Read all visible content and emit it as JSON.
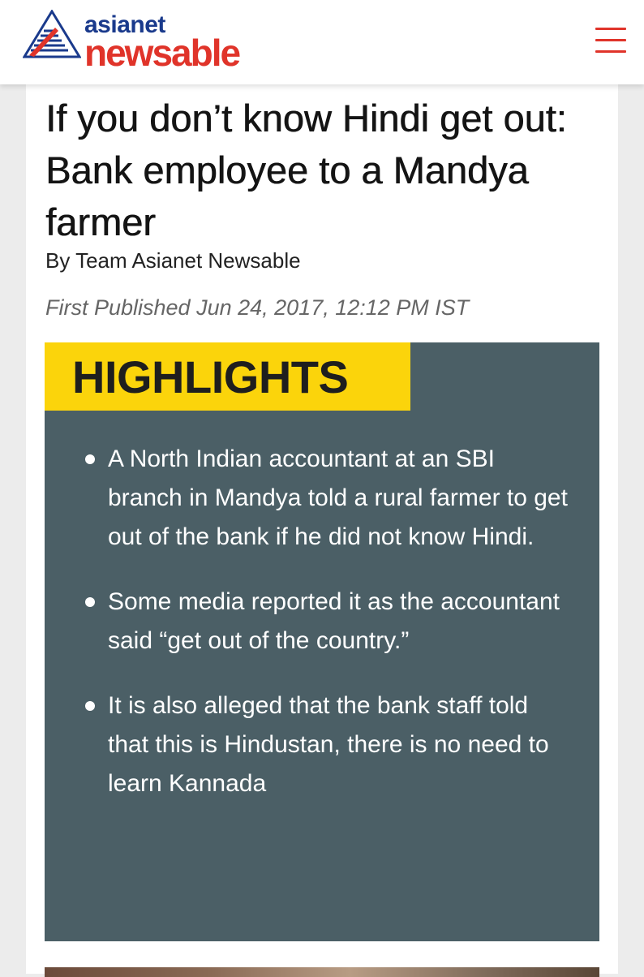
{
  "header": {
    "logo_top": "asianet",
    "logo_bottom": "newsable",
    "menu_icon": "hamburger-menu-icon",
    "brand_blue": "#1a3a8c",
    "brand_red": "#e0342a"
  },
  "article": {
    "title": "If you don’t know Hindi get out: Bank employee to a Mandya farmer",
    "byline": "By Team Asianet Newsable",
    "published": "First Published Jun 24, 2017, 12:12 PM IST"
  },
  "highlights": {
    "heading": "HIGHLIGHTS",
    "badge_color": "#fbd40b",
    "panel_color": "#4b5f66",
    "items": [
      "A North Indian accountant at an SBI branch in Mandya told a rural farmer to get out of the bank if he did not know Hindi.",
      "Some media reported it as the accountant said “get out of the country.”",
      "It is also alleged that the bank staff told that this is Hindustan, there is no need to learn Kannada"
    ]
  }
}
